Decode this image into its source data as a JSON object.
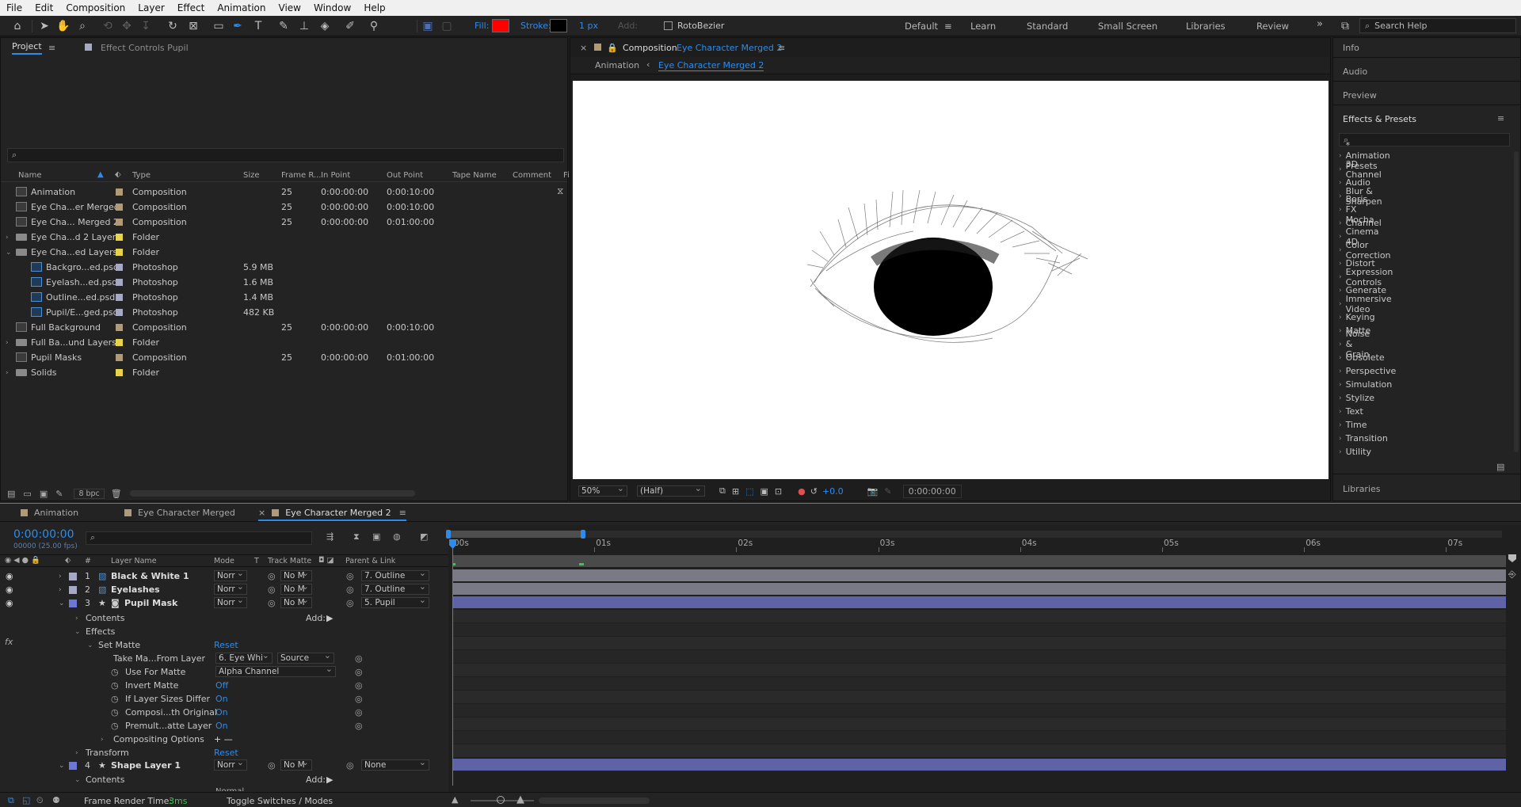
{
  "menu": [
    "File",
    "Edit",
    "Composition",
    "Layer",
    "Effect",
    "Animation",
    "View",
    "Window",
    "Help"
  ],
  "toolbar": {
    "fill_label": "Fill:",
    "fill_color": "#ff0000",
    "stroke_label": "Stroke:",
    "stroke_width": "1 px",
    "add_label": "Add:",
    "rotobezier": "RotoBezier",
    "workspaces": [
      "Default",
      "Learn",
      "Standard",
      "Small Screen",
      "Libraries",
      "Review"
    ],
    "active_workspace": "Default",
    "more": "»",
    "search_help": "Search Help"
  },
  "project": {
    "tab": "Project",
    "effect_controls": "Effect Controls Pupil",
    "search_placeholder": "",
    "columns": [
      "Name",
      "Type",
      "Size",
      "Frame R...",
      "In Point",
      "Out Point",
      "Tape Name",
      "Comment",
      "Fi"
    ],
    "items": [
      {
        "name": "Animation",
        "type": "Composition",
        "size": "",
        "fr": "25",
        "in": "0:00:00:00",
        "out": "0:00:10:00",
        "icon": "comp",
        "label": "#b09a78",
        "arrow": ""
      },
      {
        "name": "Eye Cha...er Merged",
        "type": "Composition",
        "size": "",
        "fr": "25",
        "in": "0:00:00:00",
        "out": "0:00:10:00",
        "icon": "comp",
        "label": "#b09a78",
        "arrow": ""
      },
      {
        "name": "Eye Cha... Merged 2",
        "type": "Composition",
        "size": "",
        "fr": "25",
        "in": "0:00:00:00",
        "out": "0:01:00:00",
        "icon": "comp",
        "label": "#b09a78",
        "arrow": ""
      },
      {
        "name": "Eye Cha...d 2 Layers",
        "type": "Folder",
        "size": "",
        "fr": "",
        "in": "",
        "out": "",
        "icon": "folder",
        "label": "#e8d44a",
        "arrow": "›"
      },
      {
        "name": "Eye Cha...ed Layers",
        "type": "Folder",
        "size": "",
        "fr": "",
        "in": "",
        "out": "",
        "icon": "folder",
        "label": "#e8d44a",
        "arrow": "⌄"
      },
      {
        "name": "Backgro...ed.psd",
        "type": "Photoshop",
        "size": "5.9 MB",
        "fr": "",
        "in": "",
        "out": "",
        "icon": "ps",
        "label": "#a6a8c6",
        "arrow": "",
        "indent": true
      },
      {
        "name": "Eyelash...ed.psd",
        "type": "Photoshop",
        "size": "1.6 MB",
        "fr": "",
        "in": "",
        "out": "",
        "icon": "ps",
        "label": "#a6a8c6",
        "arrow": "",
        "indent": true
      },
      {
        "name": "Outline...ed.psd",
        "type": "Photoshop",
        "size": "1.4 MB",
        "fr": "",
        "in": "",
        "out": "",
        "icon": "ps",
        "label": "#a6a8c6",
        "arrow": "",
        "indent": true
      },
      {
        "name": "Pupil/E...ged.psd",
        "type": "Photoshop",
        "size": "482 KB",
        "fr": "",
        "in": "",
        "out": "",
        "icon": "ps",
        "label": "#a6a8c6",
        "arrow": "",
        "indent": true
      },
      {
        "name": "Full Background",
        "type": "Composition",
        "size": "",
        "fr": "25",
        "in": "0:00:00:00",
        "out": "0:00:10:00",
        "icon": "comp",
        "label": "#b09a78",
        "arrow": ""
      },
      {
        "name": "Full Ba...und Layers",
        "type": "Folder",
        "size": "",
        "fr": "",
        "in": "",
        "out": "",
        "icon": "folder",
        "label": "#e8d44a",
        "arrow": "›"
      },
      {
        "name": "Pupil Masks",
        "type": "Composition",
        "size": "",
        "fr": "25",
        "in": "0:00:00:00",
        "out": "0:01:00:00",
        "icon": "comp",
        "label": "#b09a78",
        "arrow": ""
      },
      {
        "name": "Solids",
        "type": "Folder",
        "size": "",
        "fr": "",
        "in": "",
        "out": "",
        "icon": "folder",
        "label": "#e8d44a",
        "arrow": "›"
      }
    ],
    "bpc": "8 bpc"
  },
  "composition": {
    "close": "×",
    "title_prefix": "Composition",
    "title_name": "Eye Character Merged 2",
    "breadcrumb_parent": "Animation",
    "breadcrumb_current": "Eye Character Merged 2",
    "zoom": "50%",
    "resolution": "(Half)",
    "exposure": "+0.0",
    "timecode": "0:00:00:00"
  },
  "right_panels": {
    "info": "Info",
    "audio": "Audio",
    "preview": "Preview",
    "effects_presets": "Effects & Presets",
    "search_placeholder": "",
    "categories": [
      "* Animation Presets",
      "3D Channel",
      "Audio",
      "Blur & Sharpen",
      "Boris FX Mocha",
      "Channel",
      "Cinema 4D",
      "Color Correction",
      "Distort",
      "Expression Controls",
      "Generate",
      "Immersive Video",
      "Keying",
      "Matte",
      "Noise & Grain",
      "Obsolete",
      "Perspective",
      "Simulation",
      "Stylize",
      "Text",
      "Time",
      "Transition",
      "Utility"
    ],
    "libraries": "Libraries"
  },
  "timeline": {
    "tabs": [
      {
        "label": "Animation",
        "active": false
      },
      {
        "label": "Eye Character Merged",
        "active": false
      },
      {
        "label": "Eye Character Merged 2",
        "active": true
      }
    ],
    "timecode": "0:00:00:00",
    "fps": "00000 (25.00 fps)",
    "columns": {
      "num": "#",
      "layer_name": "Layer Name",
      "mode": "Mode",
      "t": "T",
      "track_matte": "Track Matte",
      "parent": "Parent & Link"
    },
    "ruler": [
      "00s",
      "01s",
      "02s",
      "03s",
      "04s",
      "05s",
      "06s",
      "07s"
    ],
    "layers": [
      {
        "num": "1",
        "name": "Black & White 1",
        "mode": "Norr",
        "matte": "No M",
        "parent": "7. Outline",
        "label": "#a6a8c6"
      },
      {
        "num": "2",
        "name": "Eyelashes",
        "mode": "Norr",
        "matte": "No M",
        "parent": "7. Outline",
        "label": "#a6a8c6"
      },
      {
        "num": "3",
        "name": "Pupil Mask",
        "mode": "Norr",
        "matte": "No M",
        "parent": "5. Pupil",
        "label": "#6d78d6"
      },
      {
        "num": "4",
        "name": "Shape Layer 1",
        "mode": "Norr",
        "matte": "No M",
        "parent": "None",
        "label": "#6d78d6"
      }
    ],
    "props": {
      "contents": "Contents",
      "add": "Add:",
      "effects": "Effects",
      "set_matte": "Set Matte",
      "reset": "Reset",
      "take_matte": "Take Ma...From Layer",
      "take_matte_val": "6. Eye Whi",
      "take_matte_src": "Source",
      "use_for_matte": "Use For Matte",
      "use_for_matte_val": "Alpha Channel",
      "invert_matte": "Invert Matte",
      "invert_val": "Off",
      "if_sizes": "If Layer Sizes Differ",
      "if_sizes_val": "On",
      "composite": "Composi...th Original",
      "composite_val": "On",
      "premult": "Premult...atte Layer",
      "premult_val": "On",
      "compositing_options": "Compositing Options",
      "plusminus": "+ —",
      "transform": "Transform",
      "transform_reset": "Reset",
      "contents2": "Contents",
      "add2": "Add:",
      "normal_partial": "Normal"
    },
    "frame_render_label": "Frame Render Time:",
    "frame_render_val": "3ms",
    "toggle": "Toggle Switches / Modes"
  }
}
